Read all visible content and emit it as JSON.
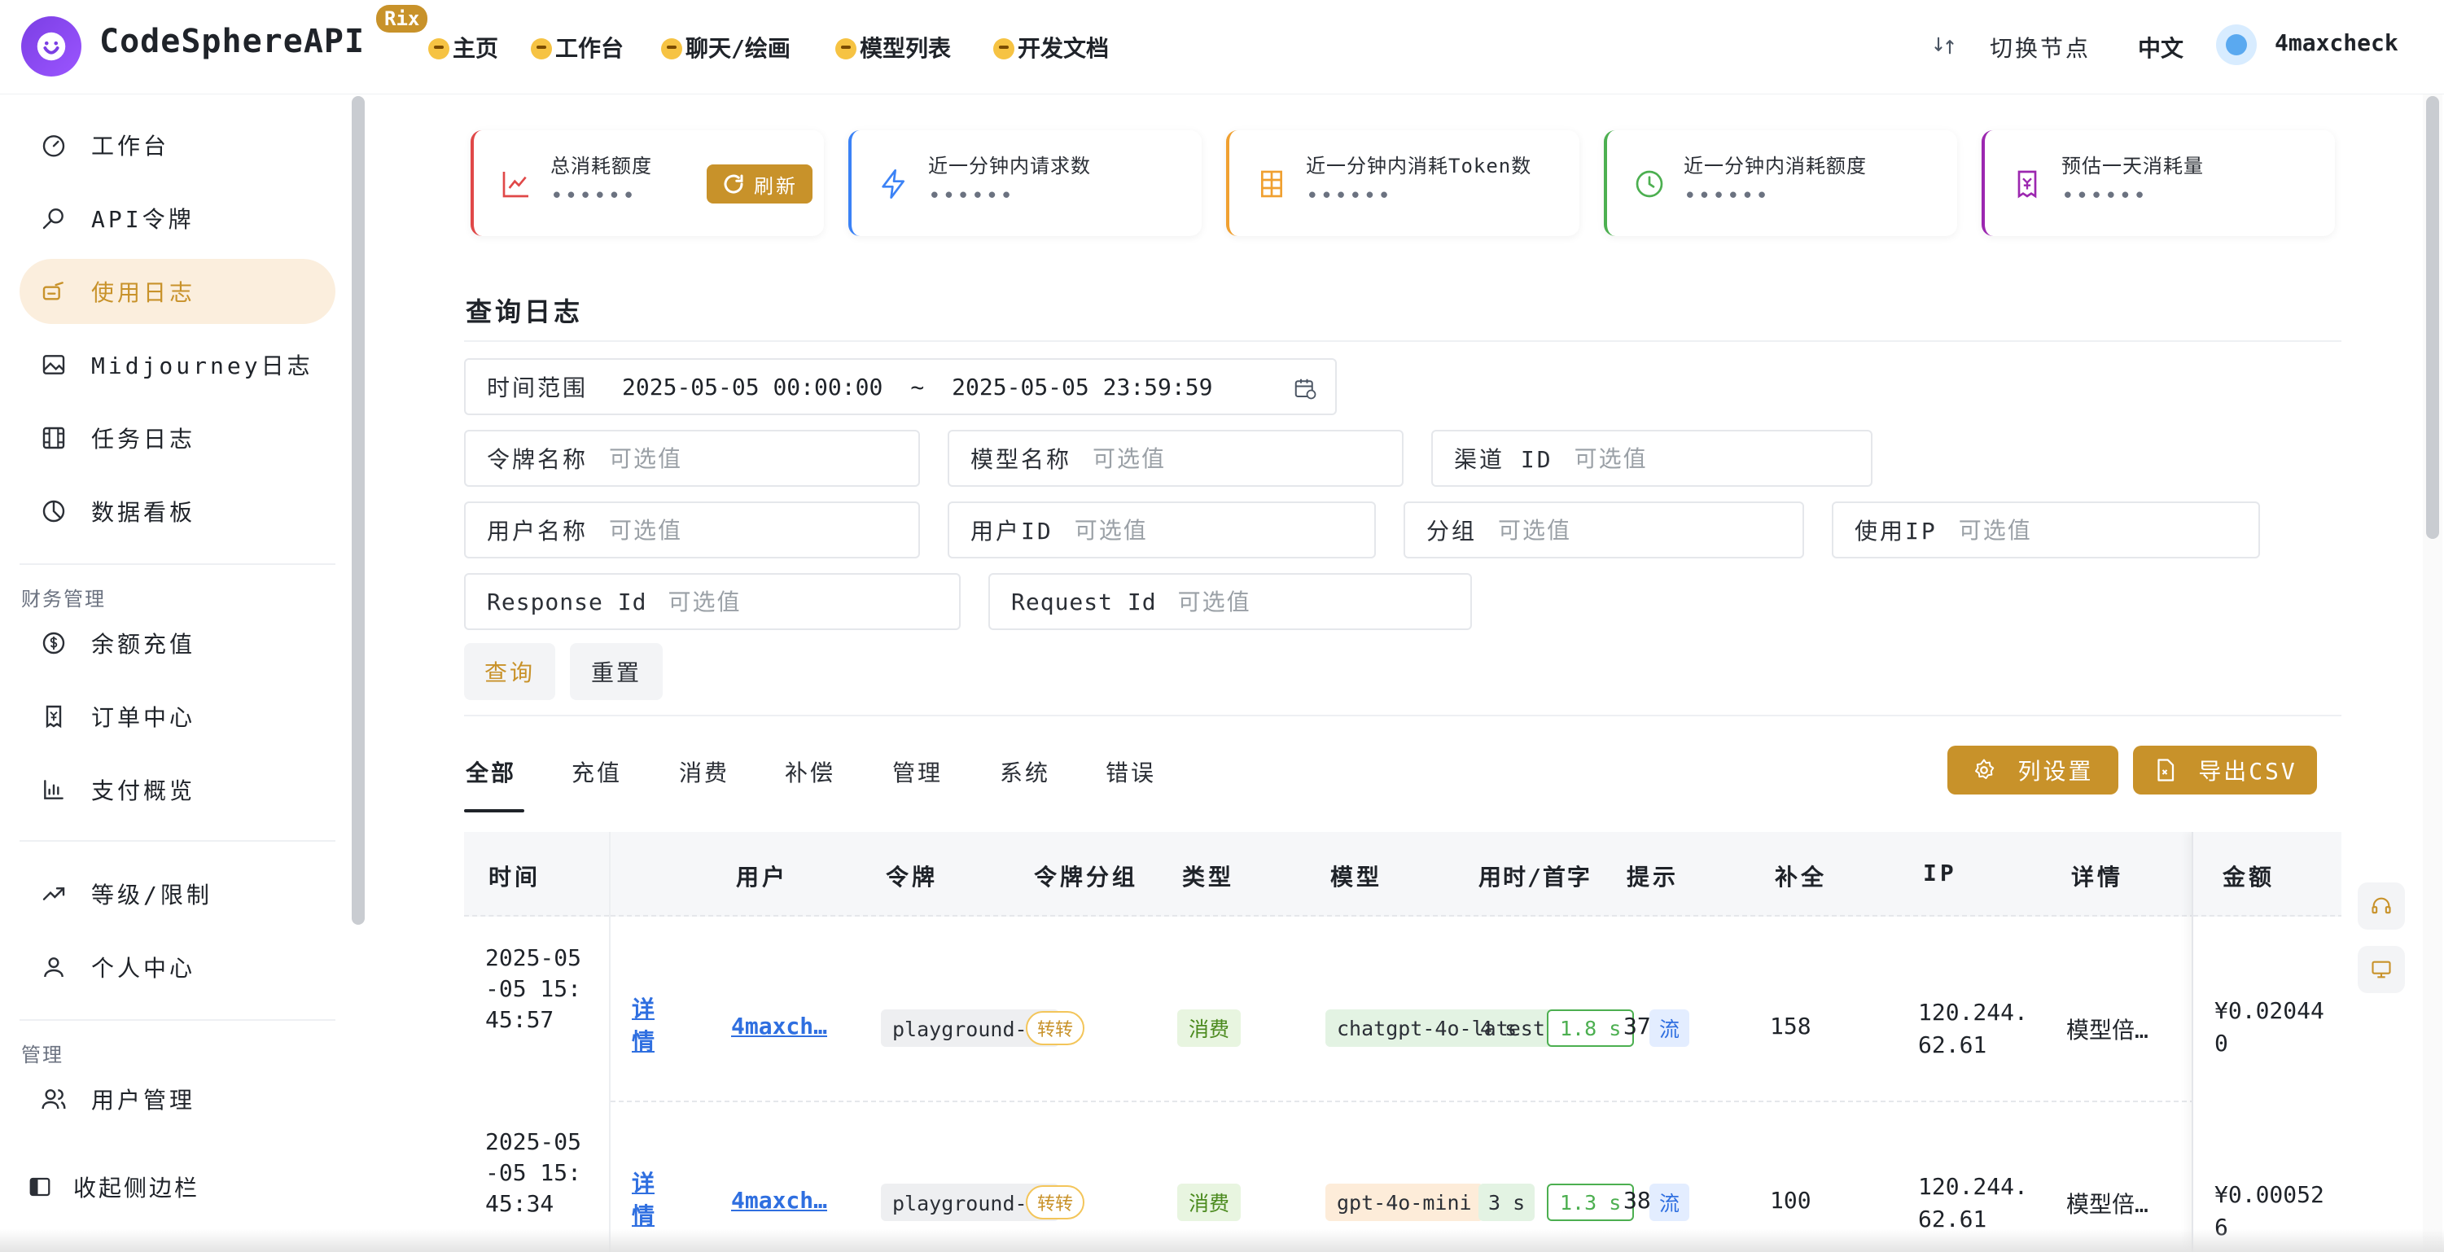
{
  "header": {
    "brand": "CodeSphereAPI",
    "badge": "Rix",
    "nav": [
      {
        "label": "主页"
      },
      {
        "label": "工作台"
      },
      {
        "label": "聊天/绘画"
      },
      {
        "label": "模型列表"
      },
      {
        "label": "开发文档"
      }
    ],
    "switch_node": "切换节点",
    "language": "中文",
    "username": "4maxcheck"
  },
  "sidebar": {
    "items": [
      {
        "label": "工作台",
        "icon": "dashboard-icon"
      },
      {
        "label": "API令牌",
        "icon": "key-icon"
      },
      {
        "label": "使用日志",
        "icon": "log-icon",
        "active": true
      },
      {
        "label": "Midjourney日志",
        "icon": "image-icon"
      },
      {
        "label": "任务日志",
        "icon": "film-icon"
      },
      {
        "label": "数据看板",
        "icon": "pie-chart-icon"
      }
    ],
    "finance_group": "财务管理",
    "finance_items": [
      {
        "label": "余额充值",
        "icon": "coin-icon"
      },
      {
        "label": "订单中心",
        "icon": "receipt-icon"
      },
      {
        "label": "支付概览",
        "icon": "bar-chart-icon"
      }
    ],
    "misc_items": [
      {
        "label": "等级/限制",
        "icon": "trend-icon"
      },
      {
        "label": "个人中心",
        "icon": "user-icon"
      }
    ],
    "admin_group": "管理",
    "admin_items": [
      {
        "label": "用户管理",
        "icon": "users-icon"
      }
    ],
    "collapse_label": "收起侧边栏"
  },
  "stats": [
    {
      "title": "总消耗额度",
      "value": "••••••",
      "color": "#e04848"
    },
    {
      "title": "近一分钟内请求数",
      "value": "••••••",
      "color": "#3b82f6"
    },
    {
      "title": "近一分钟内消耗Token数",
      "value": "••••••",
      "color": "#f0a030"
    },
    {
      "title": "近一分钟内消耗额度",
      "value": "••••••",
      "color": "#4caf50"
    },
    {
      "title": "预估一天消耗量",
      "value": "••••••",
      "color": "#9c27b0"
    }
  ],
  "refresh_label": "刷新",
  "query": {
    "title": "查询日志",
    "time_range_label": "时间范围",
    "start": "2025-05-05 00:00:00",
    "tilde": "~",
    "end": "2025-05-05 23:59:59",
    "placeholder": "可选值",
    "token_name": "令牌名称",
    "model_name": "模型名称",
    "channel_id": "渠道 ID",
    "user_name": "用户名称",
    "user_id": "用户ID",
    "group": "分组",
    "use_ip": "使用IP",
    "response_id": "Response Id",
    "request_id": "Request Id",
    "query_btn": "查询",
    "reset_btn": "重置"
  },
  "tabs": [
    "全部",
    "充值",
    "消费",
    "补偿",
    "管理",
    "系统",
    "错误"
  ],
  "actions": {
    "columns": "列设置",
    "export": "导出CSV"
  },
  "table": {
    "columns": [
      "时间",
      "用户",
      "令牌",
      "令牌分组",
      "类型",
      "模型",
      "用时/首字",
      "提示",
      "补全",
      "IP",
      "详情",
      "金额"
    ],
    "rows": [
      {
        "time": "2025-05-05 15:45:57",
        "detail": "详情",
        "user": "4maxch…",
        "token": "playground-官",
        "group": "转转",
        "type": "消费",
        "model": "chatgpt-4o-latest",
        "use_time": "4 s",
        "first_token": "1.8 s",
        "stream": "流",
        "prompt": "37",
        "completion": "158",
        "ip": "120.244.62.61",
        "remark": "模型倍…",
        "amount": "¥0.020440"
      },
      {
        "time": "2025-05-05 15:45:34",
        "detail": "详情",
        "user": "4maxch…",
        "token": "playground-官",
        "group": "转转",
        "type": "消费",
        "model": "gpt-4o-mini",
        "use_time": "3 s",
        "first_token": "1.3 s",
        "stream": "流",
        "prompt": "38",
        "completion": "100",
        "ip": "120.244.62.61",
        "remark": "模型倍…",
        "amount": "¥0.000526"
      }
    ]
  }
}
